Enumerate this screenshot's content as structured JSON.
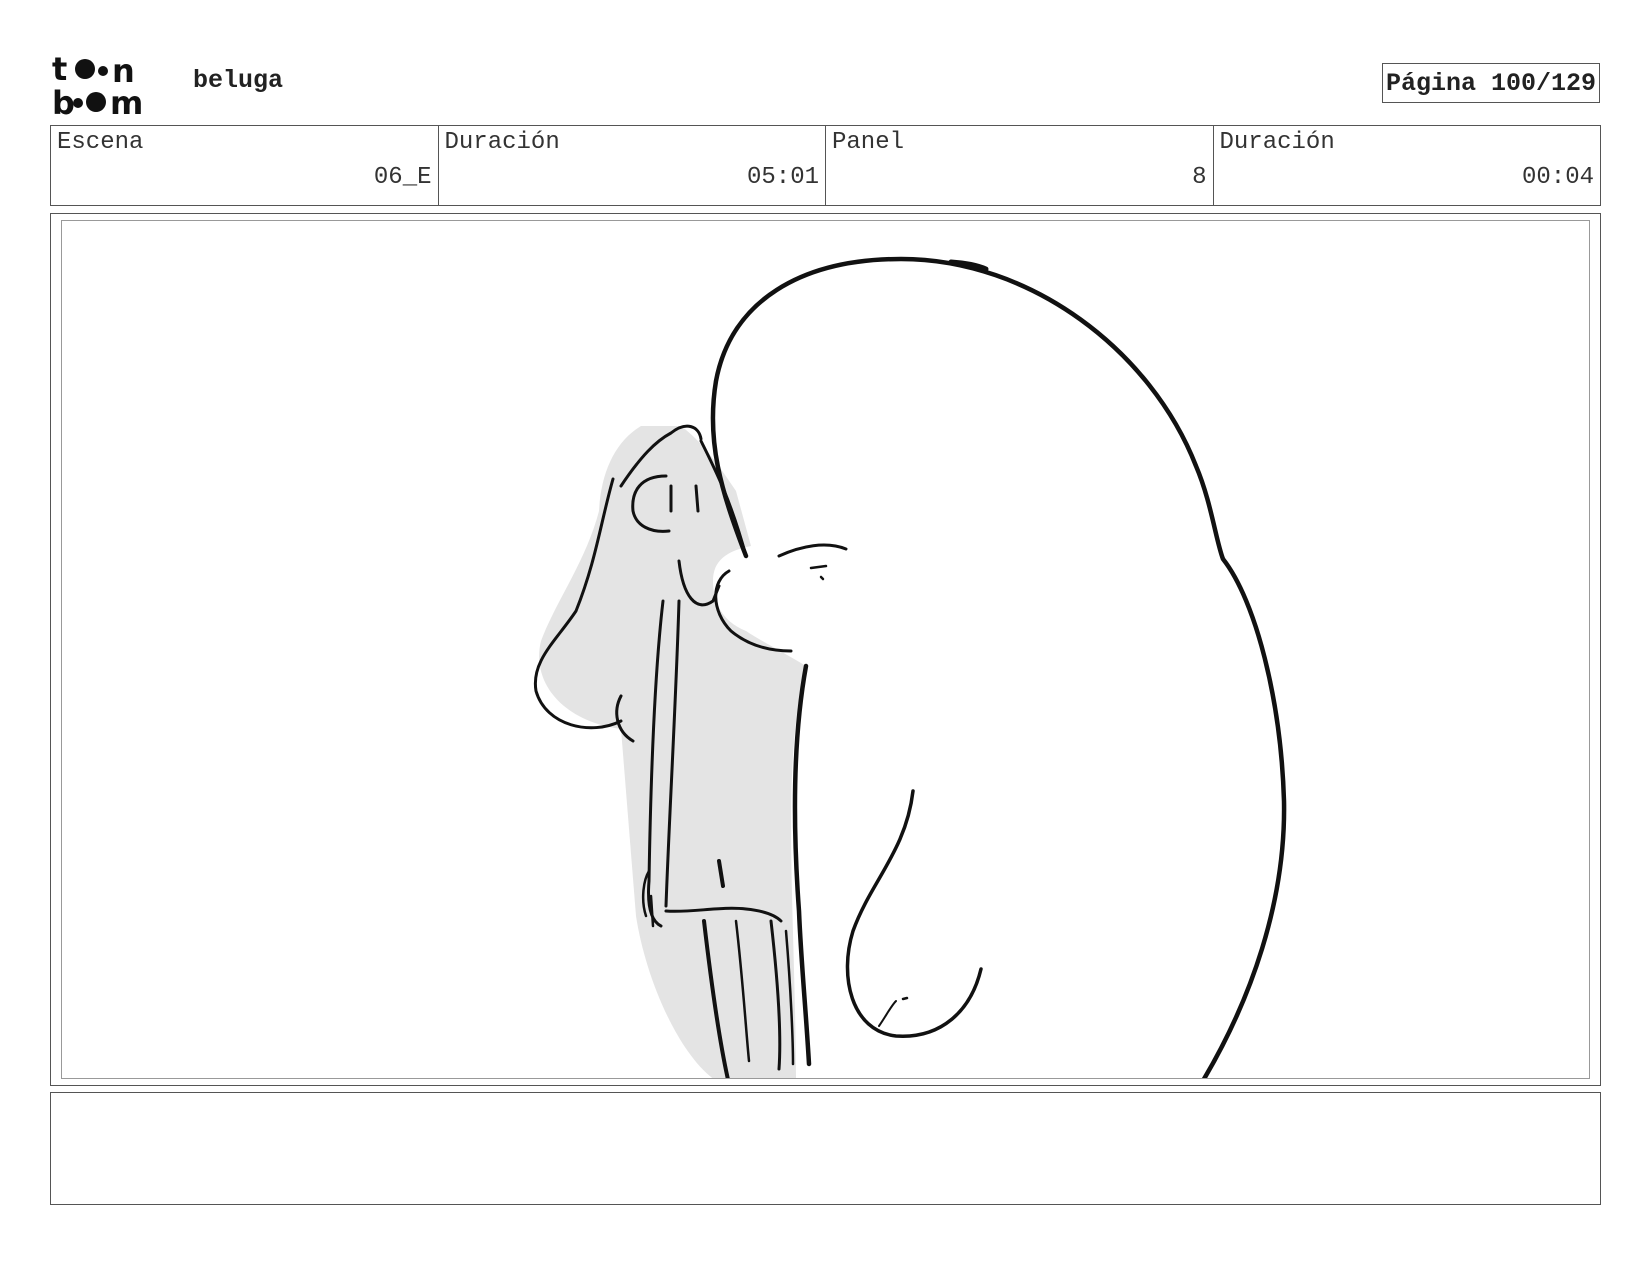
{
  "brand": {
    "logo_text": "toon boom",
    "logo_icon": "toon-boom-logo"
  },
  "project": {
    "name": "beluga"
  },
  "page": {
    "label": "Página 100/129"
  },
  "info": {
    "scene_label": "Escena",
    "scene_value": "06_E",
    "scene_duration_label": "Duración",
    "scene_duration_value": "05:01",
    "panel_label": "Panel",
    "panel_value": "8",
    "panel_duration_label": "Duración",
    "panel_duration_value": "00:04"
  },
  "drawing": {
    "subject": "storyboard-sketch-whale-and-girl",
    "line_color": "#111111",
    "shade_color": "#e4e4e4"
  },
  "notes": {
    "text": ""
  }
}
